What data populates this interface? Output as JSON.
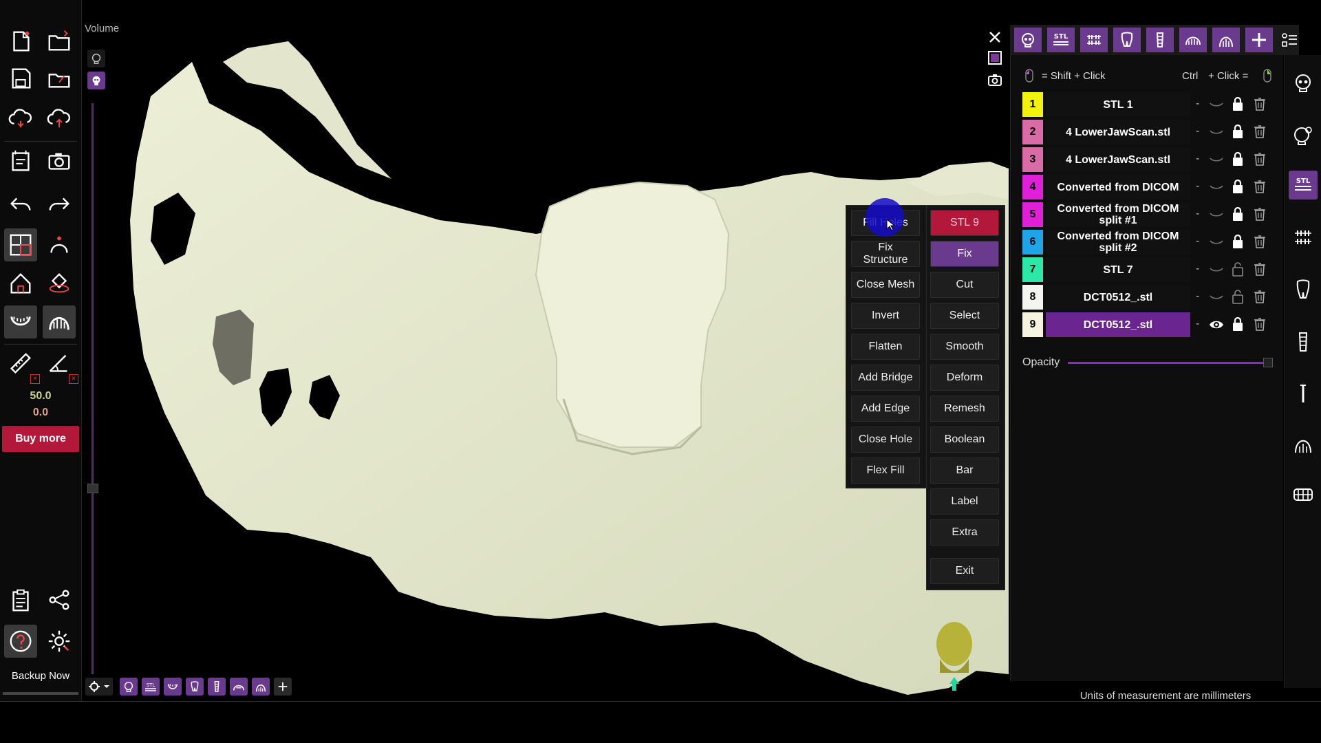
{
  "viewport": {
    "volume_label": "Volume"
  },
  "left_toolbar": {
    "value_a": "50.0",
    "value_b": "0.0",
    "buy_more": "Buy more",
    "backup_now": "Backup Now"
  },
  "context_menu": {
    "left": [
      "Fill Holes",
      "Fix Structure",
      "Close Mesh",
      "Invert",
      "Flatten",
      "Add Bridge",
      "Add Edge",
      "Close Hole",
      "Flex Fill"
    ],
    "right_title": "STL 9",
    "right": [
      "Fix",
      "Cut",
      "Select",
      "Smooth",
      "Deform",
      "Remesh",
      "Boolean",
      "Bar",
      "Label",
      "Extra",
      "Exit"
    ]
  },
  "shortcuts": {
    "shift_click": "= Shift + Click",
    "ctrl": "Ctrl",
    "click_eq": "+ Click ="
  },
  "stl_list": [
    {
      "num": "1",
      "name": "STL 1",
      "color": "#f2f20a",
      "visible": false,
      "locked": true
    },
    {
      "num": "2",
      "name": "4 LowerJawScan.stl",
      "color": "#d96ba6",
      "visible": false,
      "locked": true
    },
    {
      "num": "3",
      "name": "4 LowerJawScan.stl",
      "color": "#d96ba6",
      "visible": false,
      "locked": true
    },
    {
      "num": "4",
      "name": "Converted from DICOM",
      "color": "#e020d8",
      "visible": false,
      "locked": true
    },
    {
      "num": "5",
      "name": "Converted from DICOM split #1",
      "color": "#e020d8",
      "visible": false,
      "locked": true
    },
    {
      "num": "6",
      "name": "Converted from DICOM split #2",
      "color": "#20a4e8",
      "visible": false,
      "locked": true
    },
    {
      "num": "7",
      "name": "STL 7",
      "color": "#2ce8a8",
      "visible": false,
      "locked": false
    },
    {
      "num": "8",
      "name": "DCT0512_.stl",
      "color": "#f4f4f0",
      "visible": false,
      "locked": false
    },
    {
      "num": "9",
      "name": "DCT0512_.stl",
      "color": "#f4f4e0",
      "visible": true,
      "locked": true,
      "selected": true
    }
  ],
  "opacity_label": "Opacity",
  "opacity_value": 1.0,
  "units_note": "Units of measurement are millimeters",
  "top_tabs": [
    "skull-icon",
    "stl-icon",
    "jaw-icon",
    "tooth-icon",
    "implant-icon",
    "nerve-icon",
    "arch-icon",
    "add-icon",
    "list-icon"
  ],
  "side_tabs": [
    "skull-icon",
    "skull-gear-icon",
    "stl-icon",
    "jaw-icon",
    "tooth-icon",
    "implant-icon",
    "pin-icon",
    "arch-icon",
    "dentition-icon"
  ],
  "stl_tab_label": "STL",
  "accent_color": "#6a3a8f",
  "alert_color": "#b3183b"
}
